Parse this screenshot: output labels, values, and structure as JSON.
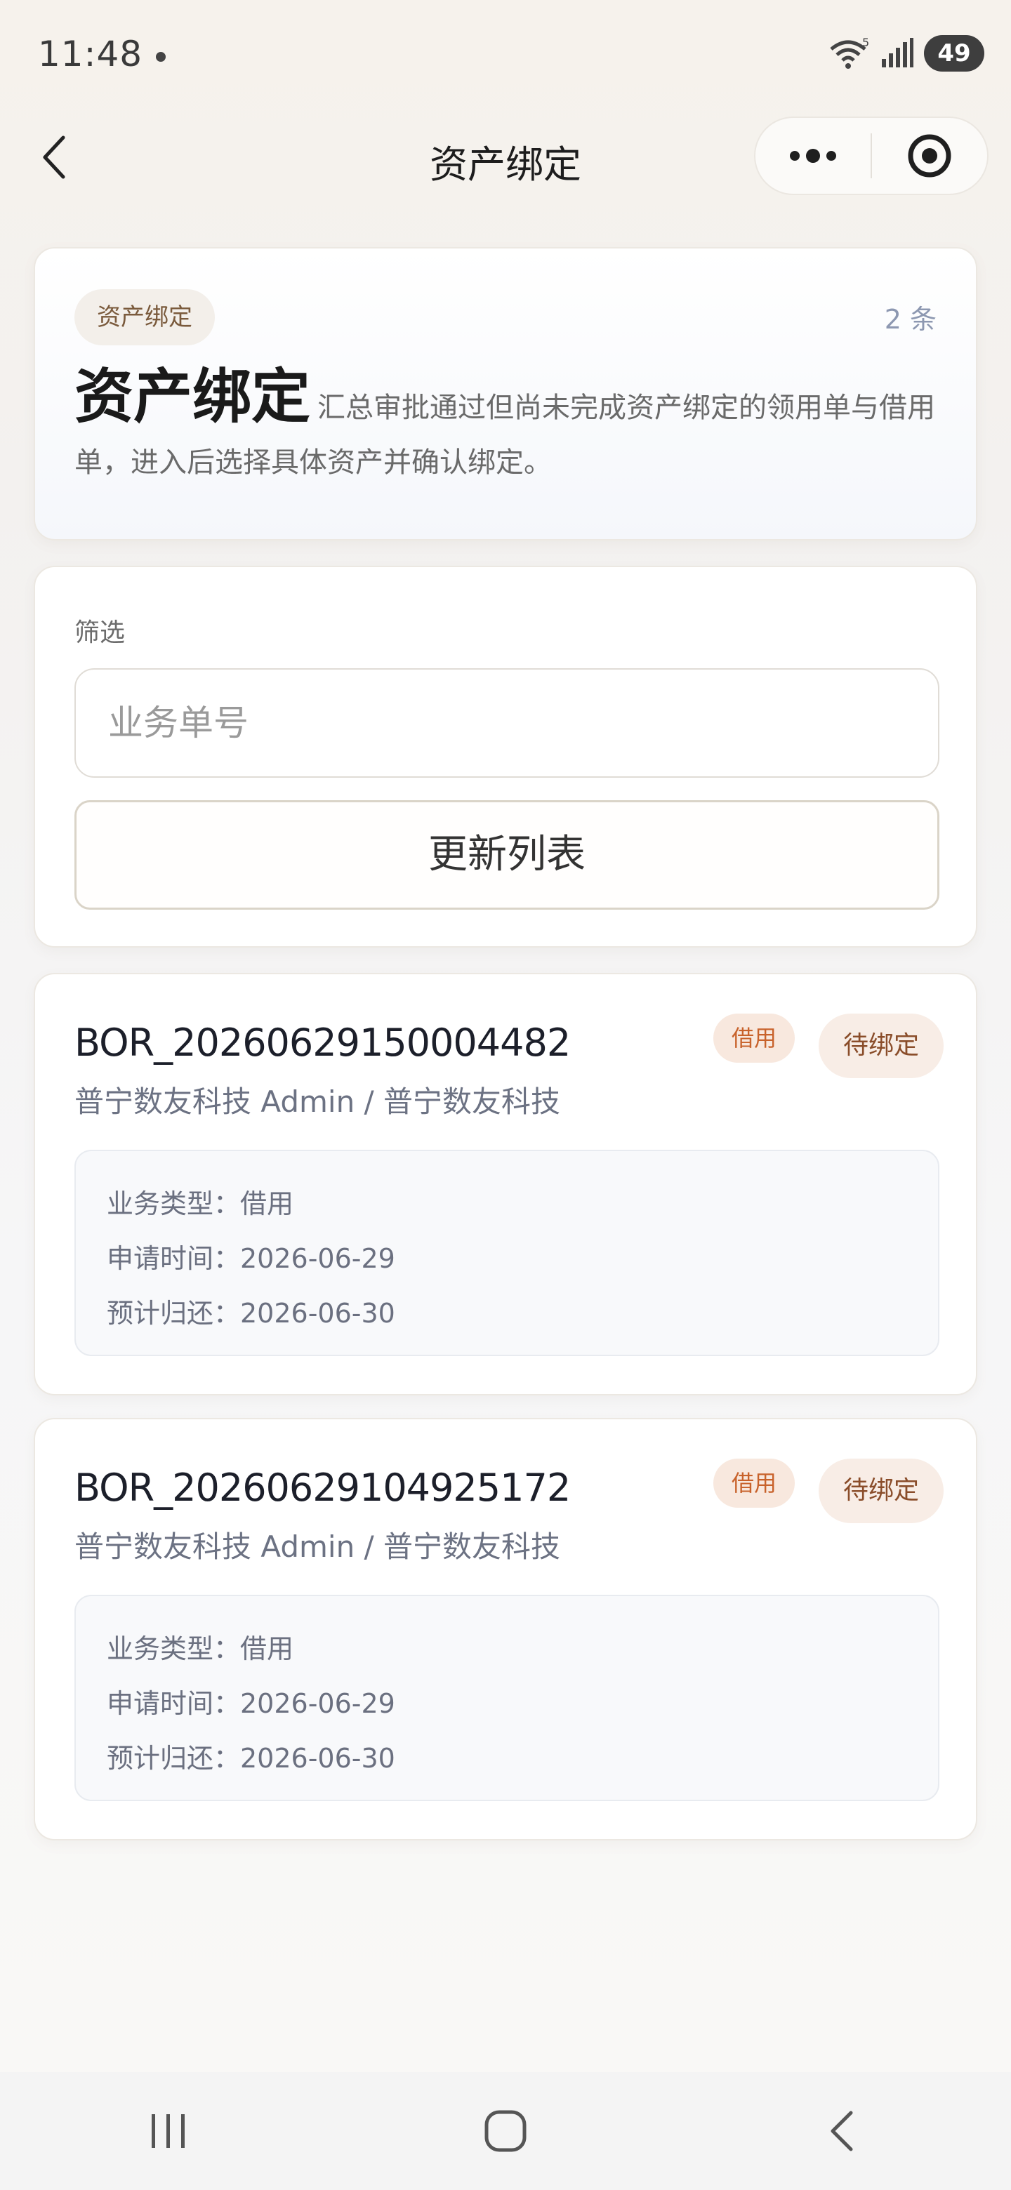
{
  "status_bar": {
    "time": "11:48",
    "battery": "49",
    "icons": [
      "wifi-icon",
      "signal-icon",
      "battery-icon"
    ]
  },
  "nav": {
    "title": "资产绑定",
    "back_icon": "chevron-left-icon",
    "more_icon": "more-icon",
    "target_icon": "target-icon"
  },
  "hero": {
    "tag": "资产绑定",
    "count": "2 条",
    "title": "资产绑定",
    "description": "汇总审批通过但尚未完成资产绑定的领用单与借用单，进入后选择具体资产并确认绑定。"
  },
  "filter": {
    "label": "筛选",
    "placeholder": "业务单号",
    "value": "",
    "refresh_label": "更新列表"
  },
  "records": [
    {
      "id": "BOR_20260629150004482",
      "type_badge": "借用",
      "status_badge": "待绑定",
      "org": "普宁数友科技 Admin / 普宁数友科技",
      "business_type": "业务类型：借用",
      "apply_time": "申请时间：2026-06-29",
      "expected_return": "预计归还：2026-06-30"
    },
    {
      "id": "BOR_20260629104925172",
      "type_badge": "借用",
      "status_badge": "待绑定",
      "org": "普宁数友科技 Admin / 普宁数友科技",
      "business_type": "业务类型：借用",
      "apply_time": "申请时间：2026-06-29",
      "expected_return": "预计归还：2026-06-30"
    }
  ],
  "bottom_nav": {
    "items": [
      "recent-apps-icon",
      "home-icon",
      "back-icon"
    ]
  },
  "colors": {
    "accent_orange": "#c8622b",
    "badge_bg": "#f8e8de",
    "muted_blue": "#8d98b1"
  }
}
